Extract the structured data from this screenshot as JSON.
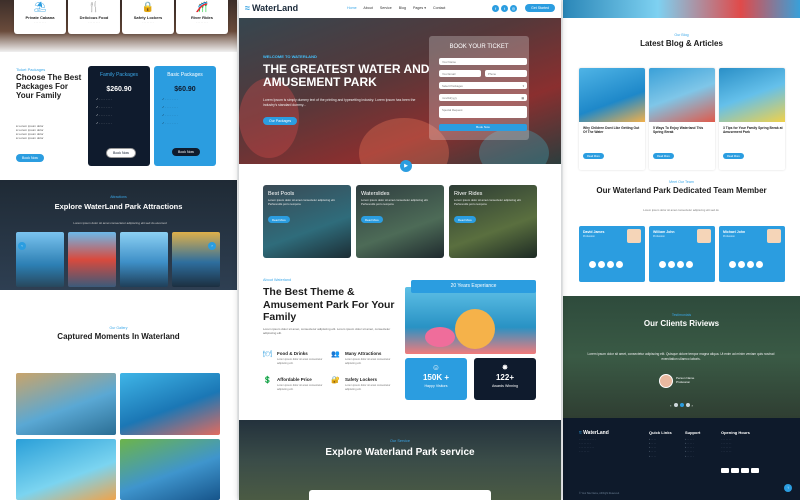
{
  "left": {
    "top_cards": [
      {
        "label": "Private Cabana",
        "icon": "cabana-icon"
      },
      {
        "label": "Delicious Food",
        "icon": "food-icon"
      },
      {
        "label": "Safety Lockers",
        "icon": "locker-icon"
      },
      {
        "label": "River Rides",
        "icon": "ride-icon"
      }
    ],
    "packages": {
      "eyebrow": "Ticket Packages",
      "title": "Choose The Best Packages For Your Family",
      "family": {
        "name": "Family Packages",
        "price": "$260.90",
        "button": "Book Now"
      },
      "basic": {
        "name": "Basic Packages",
        "price": "$60.90",
        "button": "Book Now"
      },
      "more_button": "Book Now"
    },
    "attractions": {
      "eyebrow": "Attractions",
      "title": "Explore WaterLand Park Attractions",
      "desc": "Lorem ipsum dolor sit amet consectetur adipiscing elit sed do eiusmod"
    },
    "gallery": {
      "eyebrow": "Our Gallery",
      "title": "Captured Moments In Waterland"
    }
  },
  "middle": {
    "brand": "WaterLand",
    "nav": [
      "Home",
      "About",
      "Service",
      "Blog",
      "Pages ▾",
      "Contact"
    ],
    "get_started": "Get Started",
    "hero": {
      "welcome": "WELCOME TO WATERLAND",
      "title": "THE GREATEST WATER AND AMUSEMENT PARK",
      "text": "Lorem Ipsum is simply dummy text of the printing and typesetting industry. Lorem Ipsum has been the industry's standard dummy...",
      "button": "Our Packages"
    },
    "booking": {
      "title": "BOOK YOUR TICKET",
      "fields": [
        "Your Name",
        "Your Email",
        "Phone",
        "Select Packages",
        "mm/dd/yyyy",
        "Special Request"
      ],
      "button": "Book Now"
    },
    "services": [
      {
        "title": "Best Pools",
        "desc": "Lorem ipsum dolor sit amet consectetur adipiscing elit. Perferendis porro tempora",
        "button": "Read More"
      },
      {
        "title": "Waterslides",
        "desc": "Lorem ipsum dolor sit amet consectetur adipiscing elit. Perferendis porro tempora",
        "button": "Read More"
      },
      {
        "title": "River Rides",
        "desc": "Lorem ipsum dolor sit amet consectetur adipiscing elit. Perferendis porro tempora",
        "button": "Read More"
      }
    ],
    "about": {
      "eyebrow": "About Waterland",
      "title": "The Best Theme & Amusement Park For Your Family",
      "text": "Lorem ipsum dolor sit amet, consectetur adipiscing elit. Lorem ipsum dolor sit amet, consectetur adipiscing elit.",
      "badge": "20 Years Experiance",
      "features": [
        {
          "title": "Food & Drinks",
          "icon": "food-icon",
          "desc": "Lorem ipsum dolor sit amet consectetur adipiscing elit."
        },
        {
          "title": "Many Attractions",
          "icon": "attraction-icon",
          "desc": "Lorem ipsum dolor sit amet consectetur adipiscing elit."
        },
        {
          "title": "Affordable Price",
          "icon": "price-icon",
          "desc": "Lorem ipsum dolor sit amet consectetur adipiscing elit."
        },
        {
          "title": "Safety Lockers",
          "icon": "locker-icon",
          "desc": "Lorem ipsum dolor sit amet consectetur adipiscing elit."
        }
      ],
      "stats": [
        {
          "value": "150K +",
          "label": "Happy Visitors",
          "icon": "smile-icon"
        },
        {
          "value": "122+",
          "label": "Awards Winning",
          "icon": "award-icon"
        }
      ]
    },
    "explore": {
      "eyebrow": "Our Service",
      "title": "Explore Waterland Park service"
    }
  },
  "right": {
    "blog": {
      "eyebrow": "Our Blog",
      "title": "Latest Blog & Articles",
      "posts": [
        {
          "title": "Why Children Dont Like Getting Out Of The Water",
          "button": "Read More"
        },
        {
          "title": "5 Ways To Enjoy Waterland This Spring Break",
          "button": "Read More"
        },
        {
          "title": "3 Tips for Your Family Spring Break at Amusement Park",
          "button": "Read More"
        }
      ]
    },
    "team": {
      "eyebrow": "Meet Our Team",
      "title": "Our Waterland Park Dedicated Team Member",
      "desc": "Lorem ipsum dolor sit amet consectetur adipiscing elit sed do",
      "members": [
        {
          "name": "David James",
          "role": "Profession"
        },
        {
          "name": "William John",
          "role": "Profession"
        },
        {
          "name": "Michael John",
          "role": "Profession"
        }
      ]
    },
    "testimonials": {
      "eyebrow": "Testimonials",
      "title": "Our Clients Riviews",
      "quote": "Lorem ipsum dolor sit amet, consectetur adipiscing elit. Quisque dolore tempor magna aliqua. Ut enim ad minim veniam quis nostrud exercitation ullamco laboris.",
      "person": "Person Name",
      "role": "Profession"
    },
    "footer": {
      "brand": "WaterLand",
      "headings": [
        "Quick Links",
        "Support",
        "Opening Hours"
      ],
      "copyright": "© Your Site Name, All Right Reserved."
    }
  }
}
